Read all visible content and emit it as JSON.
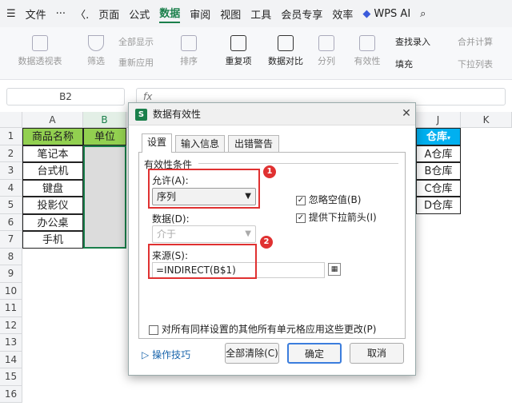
{
  "menubar": {
    "file": "文件",
    "more": "···",
    "nav": "〈.",
    "items": [
      "页面",
      "公式",
      "数据",
      "审阅",
      "视图",
      "工具",
      "会员专享",
      "效率"
    ],
    "wps_ai": "WPS AI"
  },
  "ribbon": {
    "pivot": "数据透视表",
    "filter": "筛选",
    "show_all": "全部显示",
    "reapply": "重新应用",
    "sort": "排序",
    "duplicates": "重复项",
    "compare": "数据对比",
    "split": "分列",
    "validity": "有效性",
    "lookup": "查找录入",
    "fill": "填充",
    "merge_calc": "合并计算",
    "dropdown_list": "下拉列表"
  },
  "formula_bar": {
    "name_box": "B2",
    "fx": "fx"
  },
  "sheet": {
    "left_cols": [
      "A",
      "B"
    ],
    "right_cols": [
      "J",
      "K"
    ],
    "rows": [
      "1",
      "2",
      "3",
      "4",
      "5",
      "6",
      "7",
      "8",
      "9",
      "10",
      "11",
      "12",
      "13",
      "14",
      "15",
      "16"
    ],
    "header_a": "商品名称",
    "header_b": "单位",
    "products": [
      "笔记本",
      "台式机",
      "键盘",
      "投影仪",
      "办公桌",
      "手机"
    ],
    "j_header": "仓库",
    "warehouses": [
      "A仓库",
      "B仓库",
      "C仓库",
      "D仓库"
    ]
  },
  "dialog": {
    "title": "数据有效性",
    "tabs": [
      "设置",
      "输入信息",
      "出错警告"
    ],
    "group_label": "有效性条件",
    "allow_label": "允许(A):",
    "allow_value": "序列",
    "data_label": "数据(D):",
    "data_value": "介于",
    "ignore_blank": "忽略空值(B)",
    "dropdown_arrow": "提供下拉箭头(I)",
    "source_label": "来源(S):",
    "source_value": "=INDIRECT(B$1)",
    "apply_all": "对所有同样设置的其他所有单元格应用这些更改(P)",
    "tips": "操作技巧",
    "clear_all": "全部清除(C)",
    "ok": "确定",
    "cancel": "取消",
    "badge1": "1",
    "badge2": "2"
  },
  "colors": {
    "accent": "#1a7f4b",
    "header_green": "#92d050",
    "j_header": "#00b0f0",
    "annotation": "#e03131"
  }
}
